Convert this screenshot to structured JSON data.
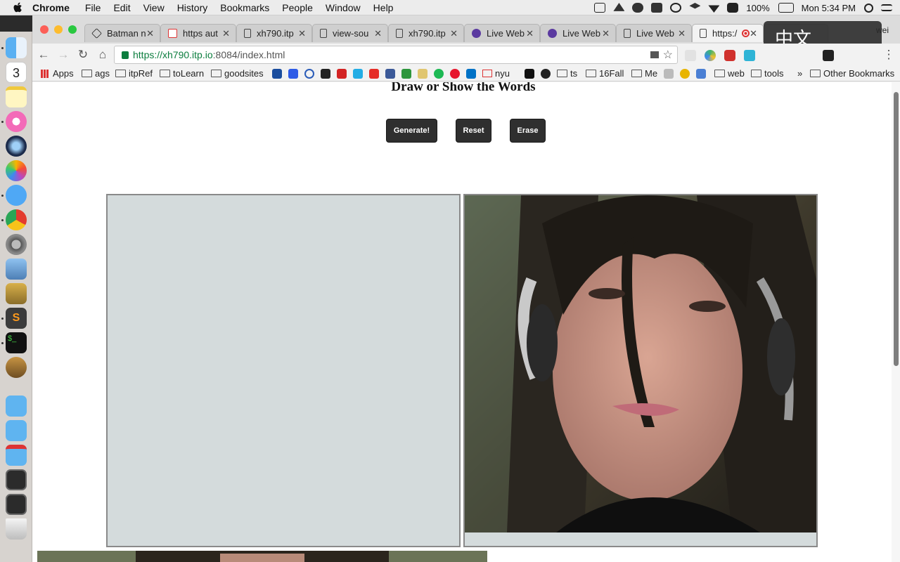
{
  "menubar": {
    "app": "Chrome",
    "items": [
      "File",
      "Edit",
      "View",
      "History",
      "Bookmarks",
      "People",
      "Window",
      "Help"
    ],
    "battery": "100%",
    "clock": "Mon 5:34 PM"
  },
  "dock": {
    "calendar_date": "3"
  },
  "tabs": [
    {
      "title": "Batman n",
      "icon": "codepen-icon"
    },
    {
      "title": "https aut",
      "icon": "gmail-icon"
    },
    {
      "title": "xh790.itp",
      "icon": "page-icon"
    },
    {
      "title": "view-sou",
      "icon": "page-icon"
    },
    {
      "title": "xh790.itp",
      "icon": "page-icon"
    },
    {
      "title": "Live Web",
      "icon": "itp-icon"
    },
    {
      "title": "Live Web",
      "icon": "itp-icon"
    },
    {
      "title": "Live Web",
      "icon": "page-icon"
    },
    {
      "title": "https:/",
      "icon": "page-icon",
      "active": true,
      "recording": true
    }
  ],
  "profile_name": "wei",
  "ime_overlay": "中文",
  "omnibox": {
    "url_host": "https://xh790.itp.io",
    "url_rest": ":8084/index.html"
  },
  "bookmarks": {
    "apps": "Apps",
    "folders": [
      "ags",
      "itpRef",
      "toLearn",
      "goodsites"
    ],
    "nyu": "nyu",
    "more_folders": [
      "ts",
      "16Fall",
      "Me"
    ],
    "web": "web",
    "tools": "tools",
    "overflow": "»",
    "other": "Other Bookmarks"
  },
  "page": {
    "title": "Draw or Show the Words",
    "buttons": {
      "generate": "Generate!",
      "reset": "Reset",
      "erase": "Erase"
    }
  },
  "colors": {
    "canvas_bg": "#d4dbdc",
    "button_bg": "#2f2f2f",
    "url_secure": "#0b7d3e"
  }
}
